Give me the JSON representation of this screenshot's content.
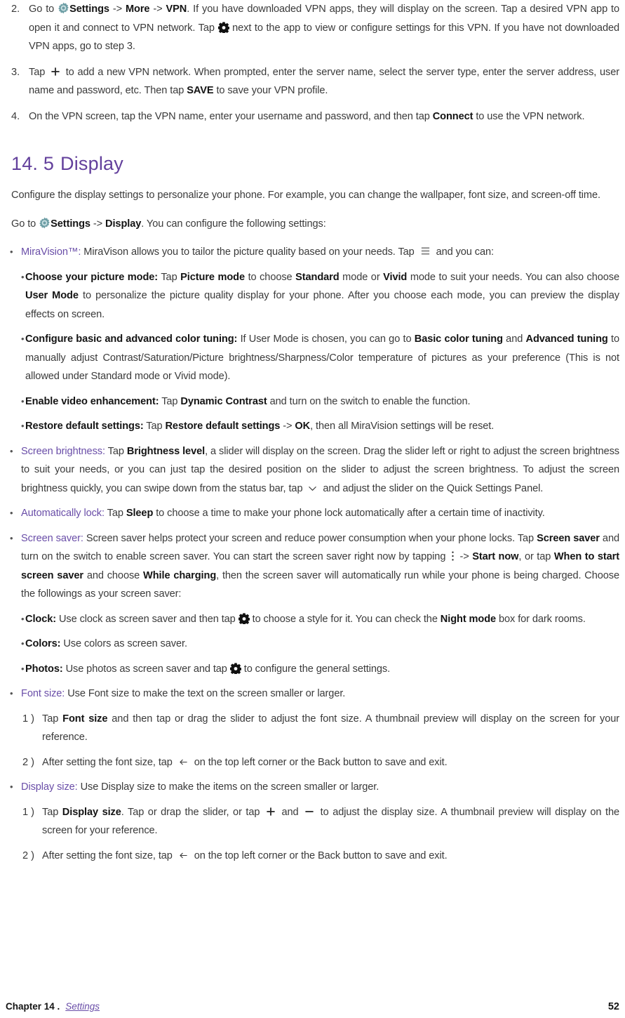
{
  "colors": {
    "heading_purple": "#63409c",
    "link_purple": "#6a4ea8",
    "body_gray": "#3a3a3a",
    "gear_color_icon": "#5f9ea0"
  },
  "top_steps": [
    {
      "number": "2.",
      "segments": [
        {
          "t": "text",
          "v": "Go to "
        },
        {
          "t": "icon",
          "v": "settings-gear-color-icon"
        },
        {
          "t": "bold",
          "v": "Settings"
        },
        {
          "t": "text",
          "v": " -> "
        },
        {
          "t": "bold",
          "v": "More"
        },
        {
          "t": "text",
          "v": " -> "
        },
        {
          "t": "bold",
          "v": "VPN"
        },
        {
          "t": "text",
          "v": ". If you have downloaded VPN apps, they will display on the screen. Tap a desired VPN app to open it and connect to VPN network. Tap "
        },
        {
          "t": "icon",
          "v": "gear-black-icon"
        },
        {
          "t": "text",
          "v": " next to the app to view or configure settings for this VPN. If you have not downloaded VPN apps, go to step 3."
        }
      ]
    },
    {
      "number": "3.",
      "segments": [
        {
          "t": "text",
          "v": "Tap "
        },
        {
          "t": "icon",
          "v": "plus-icon"
        },
        {
          "t": "text",
          "v": " to add a new VPN network. When prompted, enter the server name, select the server type, enter the server address, user name and password, etc. Then tap "
        },
        {
          "t": "bold",
          "v": "SAVE"
        },
        {
          "t": "text",
          "v": " to save your VPN profile."
        }
      ]
    },
    {
      "number": "4.",
      "segments": [
        {
          "t": "text",
          "v": "On the VPN screen, tap the VPN name, enter your username and password, and then tap "
        },
        {
          "t": "bold",
          "v": "Connect"
        },
        {
          "t": "text",
          "v": " to use the VPN network."
        }
      ]
    }
  ],
  "section": {
    "number": "14. 5",
    "title": "Display",
    "intro": "Configure the display settings to personalize your phone. For example, you can change the wallpaper, font size, and screen-off time.",
    "goto_segments": [
      {
        "t": "text",
        "v": "Go to "
      },
      {
        "t": "icon",
        "v": "settings-gear-color-icon"
      },
      {
        "t": "bold",
        "v": "Settings"
      },
      {
        "t": "text",
        "v": " -> "
      },
      {
        "t": "bold",
        "v": "Display"
      },
      {
        "t": "text",
        "v": ". You can configure the following settings:"
      }
    ]
  },
  "bullets": [
    {
      "id": "miravision",
      "segments": [
        {
          "t": "purple",
          "v": "MiraVision™:"
        },
        {
          "t": "text",
          "v": " MiraVison allows you to tailor the picture quality based on your needs. Tap "
        },
        {
          "t": "icon",
          "v": "menu-hamburger-icon"
        },
        {
          "t": "text",
          "v": " and you can:"
        }
      ],
      "sub": [
        {
          "id": "picture-mode",
          "segments": [
            {
              "t": "bold",
              "v": "Choose your picture mode:"
            },
            {
              "t": "text",
              "v": " Tap "
            },
            {
              "t": "bold",
              "v": "Picture mode"
            },
            {
              "t": "text",
              "v": " to choose "
            },
            {
              "t": "bold",
              "v": "Standard"
            },
            {
              "t": "text",
              "v": " mode or "
            },
            {
              "t": "bold",
              "v": "Vivid"
            },
            {
              "t": "text",
              "v": " mode to suit your needs. You can also choose "
            },
            {
              "t": "bold",
              "v": "User Mode"
            },
            {
              "t": "text",
              "v": " to personalize the picture quality display for your phone. After you choose each mode, you can preview the display effects on screen."
            }
          ]
        },
        {
          "id": "color-tuning",
          "segments": [
            {
              "t": "bold",
              "v": "Configure basic and advanced color tuning:"
            },
            {
              "t": "text",
              "v": " If User Mode is chosen, you can go to "
            },
            {
              "t": "bold",
              "v": "Basic color tuning"
            },
            {
              "t": "text",
              "v": " and "
            },
            {
              "t": "bold",
              "v": "Advanced tuning"
            },
            {
              "t": "text",
              "v": " to manually adjust Contrast/Saturation/Picture brightness/Sharpness/Color temperature of pictures as your preference (This is not allowed under Standard mode or Vivid mode)."
            }
          ]
        },
        {
          "id": "video-enhancement",
          "segments": [
            {
              "t": "bold",
              "v": "Enable video enhancement:"
            },
            {
              "t": "text",
              "v": " Tap "
            },
            {
              "t": "bold",
              "v": "Dynamic Contrast"
            },
            {
              "t": "text",
              "v": " and turn on the switch to enable the function."
            }
          ]
        },
        {
          "id": "restore-defaults",
          "segments": [
            {
              "t": "bold",
              "v": "Restore default settings:"
            },
            {
              "t": "text",
              "v": " Tap "
            },
            {
              "t": "bold",
              "v": "Restore default settings"
            },
            {
              "t": "text",
              "v": " -> "
            },
            {
              "t": "bold",
              "v": "OK"
            },
            {
              "t": "text",
              "v": ", then all MiraVision settings will be reset."
            }
          ]
        }
      ]
    },
    {
      "id": "screen-brightness",
      "segments": [
        {
          "t": "purple",
          "v": "Screen brightness:"
        },
        {
          "t": "text",
          "v": " Tap "
        },
        {
          "t": "bold",
          "v": "Brightness level"
        },
        {
          "t": "text",
          "v": ", a slider will display on the screen. Drag the slider left or right to adjust the screen brightness to suit your needs, or you can just tap the desired position on the slider to adjust the screen brightness. To adjust the screen brightness quickly, you can swipe down from the status bar, tap "
        },
        {
          "t": "icon",
          "v": "chevron-down-icon"
        },
        {
          "t": "text",
          "v": " and adjust the slider on the Quick Settings Panel."
        }
      ],
      "sub": []
    },
    {
      "id": "automatically-lock",
      "segments": [
        {
          "t": "purple",
          "v": "Automatically lock:"
        },
        {
          "t": "text",
          "v": " Tap "
        },
        {
          "t": "bold",
          "v": "Sleep"
        },
        {
          "t": "text",
          "v": " to choose a time to make your phone lock automatically after a certain time of inactivity."
        }
      ],
      "sub": []
    },
    {
      "id": "screen-saver",
      "segments": [
        {
          "t": "purple",
          "v": "Screen saver:"
        },
        {
          "t": "text",
          "v": " Screen saver helps protect your screen and reduce power consumption when your phone locks. Tap "
        },
        {
          "t": "bold",
          "v": "Screen saver"
        },
        {
          "t": "text",
          "v": " and turn on the switch to enable screen saver. You can start the screen saver right now by tapping "
        },
        {
          "t": "icon",
          "v": "kebab-menu-icon"
        },
        {
          "t": "text",
          "v": " -> "
        },
        {
          "t": "bold",
          "v": "Start now"
        },
        {
          "t": "text",
          "v": ", or tap "
        },
        {
          "t": "bold",
          "v": "When to start screen saver"
        },
        {
          "t": "text",
          "v": " and choose "
        },
        {
          "t": "bold",
          "v": "While charging"
        },
        {
          "t": "text",
          "v": ", then the screen saver will automatically run while your phone is being charged. Choose the followings as your screen saver:"
        }
      ],
      "sub": [
        {
          "id": "clock",
          "segments": [
            {
              "t": "bold",
              "v": "Clock:"
            },
            {
              "t": "text",
              "v": " Use clock as screen saver and then tap "
            },
            {
              "t": "icon",
              "v": "gear-black-icon"
            },
            {
              "t": "text",
              "v": " to choose a style for it. You can check the "
            },
            {
              "t": "bold",
              "v": "Night mode"
            },
            {
              "t": "text",
              "v": " box for dark rooms."
            }
          ]
        },
        {
          "id": "colors",
          "segments": [
            {
              "t": "bold",
              "v": "Colors:"
            },
            {
              "t": "text",
              "v": " Use colors as screen saver."
            }
          ]
        },
        {
          "id": "photos",
          "segments": [
            {
              "t": "bold",
              "v": "Photos:"
            },
            {
              "t": "text",
              "v": " Use photos as screen saver and tap "
            },
            {
              "t": "icon",
              "v": "gear-black-icon"
            },
            {
              "t": "text",
              "v": " to configure the general settings."
            }
          ]
        }
      ]
    },
    {
      "id": "font-size",
      "segments": [
        {
          "t": "purple",
          "v": "Font size:"
        },
        {
          "t": "text",
          "v": " Use Font size to make the text on the screen smaller or larger."
        }
      ],
      "sub": [],
      "steps": [
        {
          "number": "1 )",
          "segments": [
            {
              "t": "text",
              "v": "Tap "
            },
            {
              "t": "bold",
              "v": "Font size"
            },
            {
              "t": "text",
              "v": " and then tap or drag the slider to adjust the font size. A thumbnail preview will display on the screen for your reference."
            }
          ]
        },
        {
          "number": "2 )",
          "segments": [
            {
              "t": "text",
              "v": "After setting the font size, tap "
            },
            {
              "t": "icon",
              "v": "back-arrow-icon"
            },
            {
              "t": "text",
              "v": " on the top left corner or the Back button to save and exit."
            }
          ]
        }
      ]
    },
    {
      "id": "display-size",
      "segments": [
        {
          "t": "purple",
          "v": "Display size:"
        },
        {
          "t": "text",
          "v": " Use Display size to make the items on the screen smaller or larger."
        }
      ],
      "sub": [],
      "steps": [
        {
          "number": "1 )",
          "segments": [
            {
              "t": "text",
              "v": "Tap "
            },
            {
              "t": "bold",
              "v": "Display size"
            },
            {
              "t": "text",
              "v": ". Tap or drap the slider, or tap "
            },
            {
              "t": "icon",
              "v": "plus-icon"
            },
            {
              "t": "text",
              "v": " and "
            },
            {
              "t": "icon",
              "v": "minus-icon"
            },
            {
              "t": "text",
              "v": " to adjust the display size. A thumbnail preview will display on the screen for your reference."
            }
          ]
        },
        {
          "number": "2 )",
          "segments": [
            {
              "t": "text",
              "v": "After setting the font size, tap "
            },
            {
              "t": "icon",
              "v": "back-arrow-icon"
            },
            {
              "t": "text",
              "v": " on the top left corner or the Back button to save and exit."
            }
          ]
        }
      ]
    }
  ],
  "footer": {
    "chapter": "Chapter 14 .",
    "link": "Settings",
    "page": "52"
  }
}
